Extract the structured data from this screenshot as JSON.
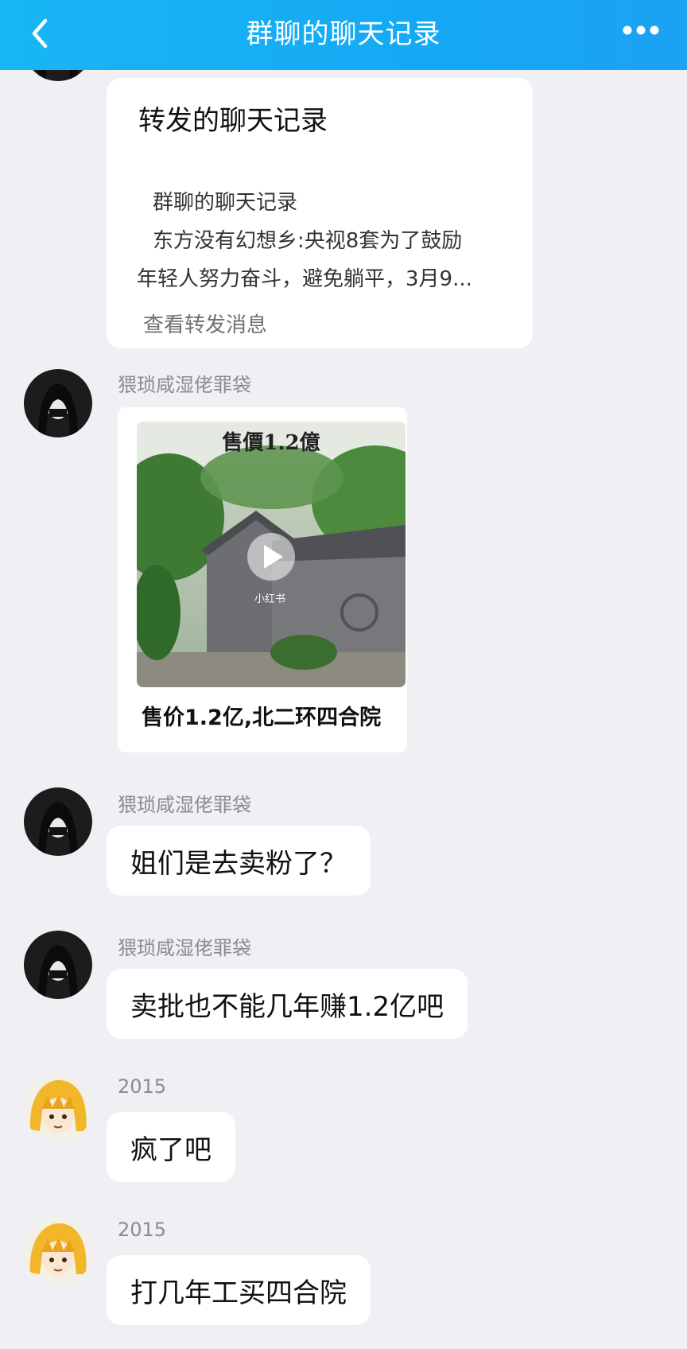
{
  "header": {
    "title": "群聊的聊天记录",
    "back_icon": "chevron-left-icon",
    "more_icon": "more-dots-icon",
    "bar_color": "#15a9f4"
  },
  "forwarded_card": {
    "title": "转发的聊天记录",
    "lines": [
      "群聊的聊天记录",
      "东方没有幻想乡:央视8套为了鼓励",
      "年轻人努力奋斗，避免躺平，3月9..."
    ],
    "view_link": "查看转发消息"
  },
  "messages": [
    {
      "sender": "猥琐咸湿佬罪袋",
      "type": "video",
      "overlay_text": "售價1.2億",
      "watermark": "小红书",
      "caption": "售价1.2亿,北二环四合院"
    },
    {
      "sender": "猥琐咸湿佬罪袋",
      "type": "text",
      "text": "姐们是去卖粉了？"
    },
    {
      "sender": "猥琐咸湿佬罪袋",
      "type": "text",
      "text": "卖批也不能几年赚1.2亿吧"
    },
    {
      "sender": "2015",
      "type": "text",
      "text": "疯了吧"
    },
    {
      "sender": "2015",
      "type": "text",
      "text": "打几年工买四合院"
    }
  ]
}
